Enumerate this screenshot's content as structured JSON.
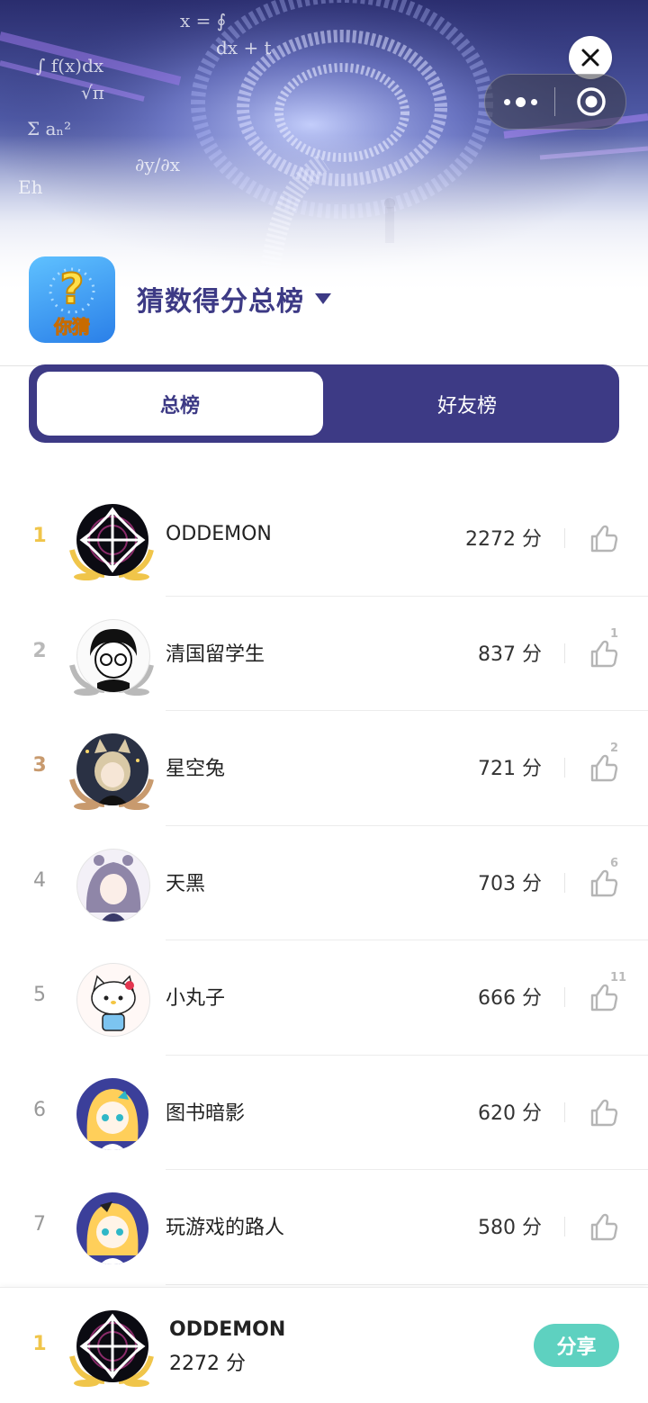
{
  "header": {
    "title": "猜数得分总榜",
    "app_icon_text": "你猜",
    "app_icon_glyph": "?"
  },
  "tabs": [
    {
      "label": "总榜",
      "active": true
    },
    {
      "label": "好友榜",
      "active": false
    }
  ],
  "colors": {
    "primary": "#3d3a85",
    "gold": "#f0c54a",
    "silver": "#b9b9b9",
    "bronze": "#c89a6e",
    "share": "#5ed1c0"
  },
  "rows": [
    {
      "rank": "1",
      "name": "ODDEMON",
      "score": "2272 分",
      "likes": "",
      "avatar": "crosshair-avatar"
    },
    {
      "rank": "2",
      "name": "清国留学生",
      "score": "837 分",
      "likes": "1",
      "avatar": "anime-boy-glasses-avatar"
    },
    {
      "rank": "3",
      "name": "星空兔",
      "score": "721 分",
      "likes": "2",
      "avatar": "anime-girl-cat-ears-avatar"
    },
    {
      "rank": "4",
      "name": "天黑",
      "score": "703 分",
      "likes": "6",
      "avatar": "anime-girl-purple-hair-avatar"
    },
    {
      "rank": "5",
      "name": "小丸子",
      "score": "666 分",
      "likes": "11",
      "avatar": "hello-kitty-avatar"
    },
    {
      "rank": "6",
      "name": "图书暗影",
      "score": "620 分",
      "likes": "",
      "avatar": "blonde-mascot-avatar"
    },
    {
      "rank": "7",
      "name": "玩游戏的路人",
      "score": "580 分",
      "likes": "",
      "avatar": "blonde-mascot-avatar"
    }
  ],
  "footer": {
    "rank": "1",
    "name": "ODDEMON",
    "score": "2272 分",
    "share_label": "分享"
  }
}
